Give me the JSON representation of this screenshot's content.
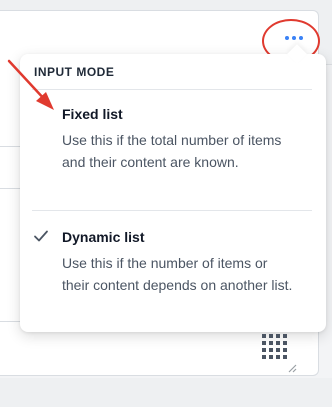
{
  "menu": {
    "header": "INPUT MODE",
    "items": [
      {
        "label": "Fixed list",
        "description": "Use this if the total number of items and their content are known.",
        "selected": false
      },
      {
        "label": "Dynamic list",
        "description": "Use this if the number of items or their content depends on another list.",
        "selected": true
      }
    ]
  },
  "icons": {
    "more": "more-horizontal-icon",
    "check": "checkmark-icon",
    "grid": "grid-icon",
    "resize": "resize-handle-icon"
  },
  "colors": {
    "accent": "#3b82f6",
    "annotation": "#e03a2f",
    "text_primary": "#111827",
    "text_secondary": "#4b5563"
  }
}
